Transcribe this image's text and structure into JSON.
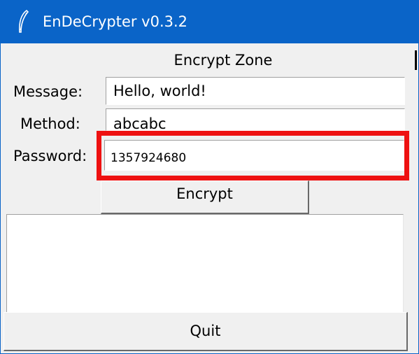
{
  "window": {
    "title": "EnDeCrypter v0.3.2",
    "icon": "feather-icon",
    "accent_color": "#0a64c8"
  },
  "zone": {
    "title": "Encrypt Zone"
  },
  "form": {
    "message_label": "Message:",
    "message_value": "Hello, world!",
    "method_label": "Method:",
    "method_value": "abcabc",
    "password_label": "Password:",
    "password_value": "1357924680"
  },
  "highlight": {
    "target": "password-field",
    "color": "#ee1111"
  },
  "buttons": {
    "encrypt_label": "Encrypt",
    "quit_label": "Quit"
  },
  "output": {
    "text": ""
  }
}
